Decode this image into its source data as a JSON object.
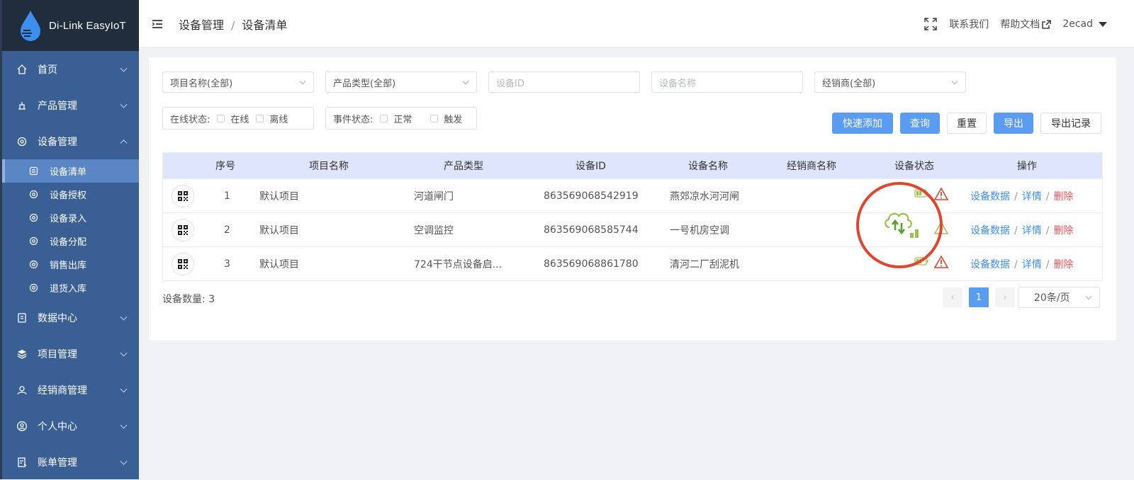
{
  "app": {
    "name": "Di-Link EasyIoT"
  },
  "sidebar": {
    "items": [
      {
        "label": "首页",
        "icon": "home-icon"
      },
      {
        "label": "产品管理",
        "icon": "product-icon"
      },
      {
        "label": "设备管理",
        "icon": "device-icon",
        "expanded": true
      },
      {
        "label": "数据中心",
        "icon": "data-icon"
      },
      {
        "label": "项目管理",
        "icon": "layers-icon"
      },
      {
        "label": "经销商管理",
        "icon": "dealer-icon"
      },
      {
        "label": "个人中心",
        "icon": "user-icon"
      },
      {
        "label": "账单管理",
        "icon": "bill-icon"
      }
    ],
    "sub_items": [
      {
        "label": "设备清单",
        "active": true
      },
      {
        "label": "设备授权"
      },
      {
        "label": "设备录入"
      },
      {
        "label": "设备分配"
      },
      {
        "label": "销售出库"
      },
      {
        "label": "退货入库"
      }
    ]
  },
  "header": {
    "breadcrumb": [
      "设备管理",
      "设备清单"
    ],
    "contact": "联系我们",
    "help": "帮助文档",
    "user": "2ecad"
  },
  "filters": {
    "project": "项目名称(全部)",
    "product_type": "产品类型(全部)",
    "device_id_placeholder": "设备ID",
    "device_name_placeholder": "设备名称",
    "dealer": "经销商(全部)",
    "online_label": "在线状态:",
    "online": "在线",
    "offline": "离线",
    "event_label": "事件状态:",
    "normal": "正常",
    "triggered": "触发"
  },
  "buttons": {
    "quick_add": "快速添加",
    "query": "查询",
    "reset": "重置",
    "export": "导出",
    "export_log": "导出记录"
  },
  "table": {
    "columns": [
      "序号",
      "项目名称",
      "产品类型",
      "设备ID",
      "设备名称",
      "经销商名称",
      "设备状态",
      "操作"
    ],
    "rows": [
      {
        "index": "1",
        "project": "默认项目",
        "product": "河道闸门",
        "device_id": "863569068542919",
        "name": "燕郊凉水河河闸",
        "dealer": ""
      },
      {
        "index": "2",
        "project": "默认项目",
        "product": "空调监控",
        "device_id": "863569068585744",
        "name": "一号机房空调",
        "dealer": ""
      },
      {
        "index": "3",
        "project": "默认项目",
        "product": "724干节点设备启...",
        "device_id": "863569068861780",
        "name": "清河二厂刮泥机",
        "dealer": ""
      }
    ],
    "actions": {
      "data": "设备数据",
      "detail": "详情",
      "delete": "删除",
      "sep": "/"
    }
  },
  "footer": {
    "count_label": "设备数量: 3",
    "current_page": "1",
    "prev": "‹",
    "next": "›",
    "page_size": "20条/页"
  },
  "colors": {
    "sidebar": "#3a5f95",
    "primary": "#5b9cf3",
    "danger": "#f2555a",
    "highlight": "#e2452f"
  }
}
